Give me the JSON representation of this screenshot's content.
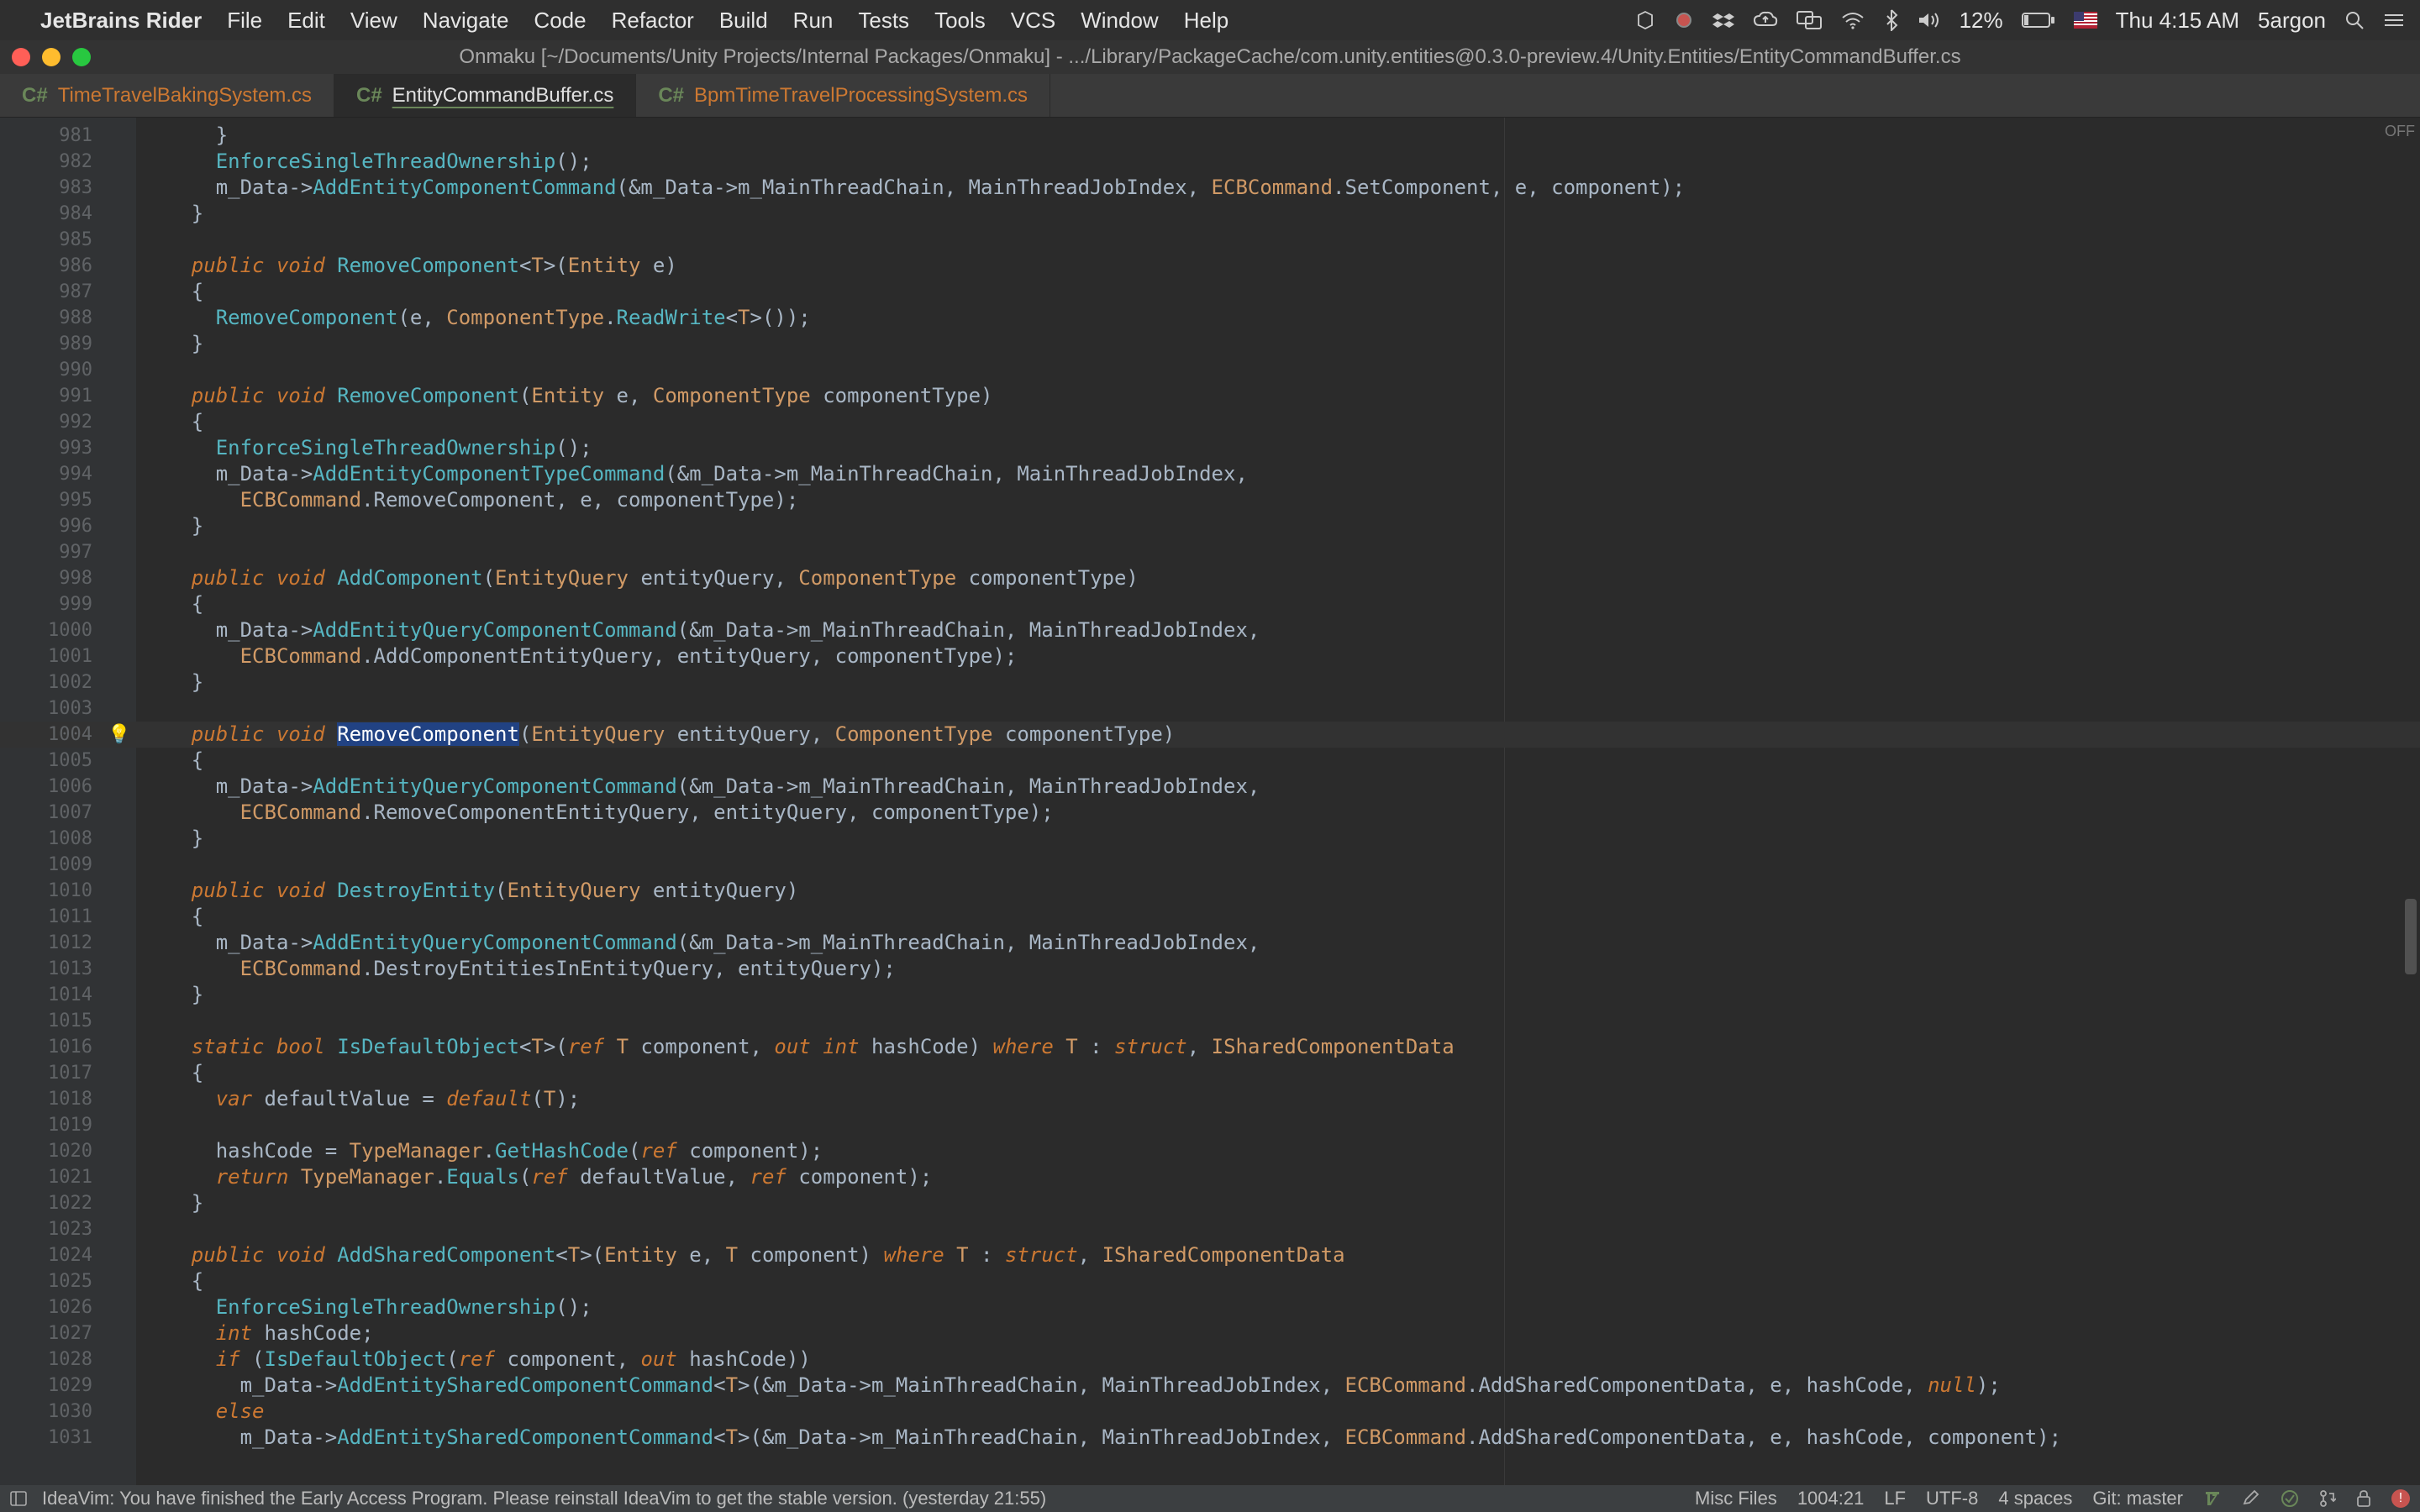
{
  "menubar": {
    "app": "JetBrains Rider",
    "items": [
      "File",
      "Edit",
      "View",
      "Navigate",
      "Code",
      "Refactor",
      "Build",
      "Run",
      "Tests",
      "Tools",
      "VCS",
      "Window",
      "Help"
    ],
    "battery": "12%",
    "clock": "Thu 4:15 AM",
    "user": "5argon"
  },
  "titlebar": "Onmaku [~/Documents/Unity Projects/Internal Packages/Onmaku] - .../Library/PackageCache/com.unity.entities@0.3.0-preview.4/Unity.Entities/EntityCommandBuffer.cs",
  "tabs": [
    {
      "lang": "C#",
      "label": "TimeTravelBakingSystem.cs",
      "active": false
    },
    {
      "lang": "C#",
      "label": "EntityCommandBuffer.cs",
      "active": true
    },
    {
      "lang": "C#",
      "label": "BpmTimeTravelProcessingSystem.cs",
      "active": false
    }
  ],
  "inspection": "OFF",
  "current_line": 1004,
  "code": [
    {
      "n": 981,
      "spans": [
        [
          "",
          "      "
        ],
        [
          "",
          "}"
        ]
      ]
    },
    {
      "n": 982,
      "spans": [
        [
          "",
          "      "
        ],
        [
          "mth",
          "EnforceSingleThreadOwnership"
        ],
        [
          "",
          "();"
        ]
      ]
    },
    {
      "n": 983,
      "spans": [
        [
          "",
          "      m_Data->"
        ],
        [
          "mth",
          "AddEntityComponentCommand"
        ],
        [
          "",
          "(&m_Data->m_MainThreadChain, MainThreadJobIndex, "
        ],
        [
          "cls",
          "ECBCommand"
        ],
        [
          "",
          "."
        ],
        [
          "id",
          "SetComponent"
        ],
        [
          "",
          ", "
        ],
        [
          "id",
          "e"
        ],
        [
          "",
          ", "
        ],
        [
          "id",
          "component"
        ],
        [
          "",
          ");"
        ]
      ]
    },
    {
      "n": 984,
      "spans": [
        [
          "",
          "    }"
        ]
      ]
    },
    {
      "n": 985,
      "spans": [
        [
          "",
          ""
        ]
      ]
    },
    {
      "n": 986,
      "spans": [
        [
          "",
          "    "
        ],
        [
          "kw",
          "public void"
        ],
        [
          "",
          ""
        ],
        [
          "",
          ""
        ],
        [
          "",
          " "
        ],
        [
          "mth",
          "RemoveComponent"
        ],
        [
          "",
          "<"
        ],
        [
          "typ",
          "T"
        ],
        [
          "",
          ">("
        ],
        [
          "typ",
          "Entity"
        ],
        [
          "",
          " e)"
        ]
      ]
    },
    {
      "n": 987,
      "spans": [
        [
          "",
          "    {"
        ]
      ]
    },
    {
      "n": 988,
      "spans": [
        [
          "",
          "      "
        ],
        [
          "mth",
          "RemoveComponent"
        ],
        [
          "",
          "(e, "
        ],
        [
          "typ",
          "ComponentType"
        ],
        [
          "",
          "."
        ],
        [
          "mth",
          "ReadWrite"
        ],
        [
          "",
          "<"
        ],
        [
          "typ",
          "T"
        ],
        [
          "",
          ">());"
        ]
      ]
    },
    {
      "n": 989,
      "spans": [
        [
          "",
          "    }"
        ]
      ]
    },
    {
      "n": 990,
      "spans": [
        [
          "",
          ""
        ]
      ]
    },
    {
      "n": 991,
      "spans": [
        [
          "",
          "    "
        ],
        [
          "kw",
          "public void"
        ],
        [
          "",
          " "
        ],
        [
          "mth",
          "RemoveComponent"
        ],
        [
          "",
          "("
        ],
        [
          "typ",
          "Entity"
        ],
        [
          "",
          " e, "
        ],
        [
          "typ",
          "ComponentType"
        ],
        [
          "",
          " componentType)"
        ]
      ]
    },
    {
      "n": 992,
      "spans": [
        [
          "",
          "    {"
        ]
      ]
    },
    {
      "n": 993,
      "spans": [
        [
          "",
          "      "
        ],
        [
          "mth",
          "EnforceSingleThreadOwnership"
        ],
        [
          "",
          "();"
        ]
      ]
    },
    {
      "n": 994,
      "spans": [
        [
          "",
          "      m_Data->"
        ],
        [
          "mth",
          "AddEntityComponentTypeCommand"
        ],
        [
          "",
          "(&m_Data->m_MainThreadChain, MainThreadJobIndex,"
        ]
      ]
    },
    {
      "n": 995,
      "spans": [
        [
          "",
          "        "
        ],
        [
          "cls",
          "ECBCommand"
        ],
        [
          "",
          "."
        ],
        [
          "id",
          "RemoveComponent"
        ],
        [
          "",
          ", e, componentType);"
        ]
      ]
    },
    {
      "n": 996,
      "spans": [
        [
          "",
          "    }"
        ]
      ]
    },
    {
      "n": 997,
      "spans": [
        [
          "",
          ""
        ]
      ]
    },
    {
      "n": 998,
      "spans": [
        [
          "",
          "    "
        ],
        [
          "kw",
          "public void"
        ],
        [
          "",
          " "
        ],
        [
          "mth",
          "AddComponent"
        ],
        [
          "",
          "("
        ],
        [
          "typ",
          "EntityQuery"
        ],
        [
          "",
          " entityQuery, "
        ],
        [
          "typ",
          "ComponentType"
        ],
        [
          "",
          " componentType)"
        ]
      ]
    },
    {
      "n": 999,
      "spans": [
        [
          "",
          "    {"
        ]
      ]
    },
    {
      "n": 1000,
      "spans": [
        [
          "",
          "      m_Data->"
        ],
        [
          "mth",
          "AddEntityQueryComponentCommand"
        ],
        [
          "",
          "(&m_Data->m_MainThreadChain, MainThreadJobIndex,"
        ]
      ]
    },
    {
      "n": 1001,
      "spans": [
        [
          "",
          "        "
        ],
        [
          "cls",
          "ECBCommand"
        ],
        [
          "",
          "."
        ],
        [
          "id",
          "AddComponentEntityQuery"
        ],
        [
          "",
          ", entityQuery, componentType);"
        ]
      ]
    },
    {
      "n": 1002,
      "spans": [
        [
          "",
          "    }"
        ]
      ]
    },
    {
      "n": 1003,
      "spans": [
        [
          "",
          ""
        ]
      ]
    },
    {
      "n": 1004,
      "spans": [
        [
          "",
          "    "
        ],
        [
          "kw",
          "public void"
        ],
        [
          "",
          " "
        ],
        [
          "sel",
          "RemoveComponent"
        ],
        [
          "",
          "("
        ],
        [
          "typ",
          "EntityQuery"
        ],
        [
          "",
          " entityQuery, "
        ],
        [
          "typ",
          "ComponentType"
        ],
        [
          "",
          " componentType)"
        ]
      ]
    },
    {
      "n": 1005,
      "spans": [
        [
          "",
          "    {"
        ]
      ]
    },
    {
      "n": 1006,
      "spans": [
        [
          "",
          "      m_Data->"
        ],
        [
          "mth",
          "AddEntityQueryComponentCommand"
        ],
        [
          "",
          "(&m_Data->m_MainThreadChain, MainThreadJobIndex,"
        ]
      ]
    },
    {
      "n": 1007,
      "spans": [
        [
          "",
          "        "
        ],
        [
          "cls",
          "ECBCommand"
        ],
        [
          "",
          "."
        ],
        [
          "id",
          "RemoveComponentEntityQuery"
        ],
        [
          "",
          ", entityQuery, componentType);"
        ]
      ]
    },
    {
      "n": 1008,
      "spans": [
        [
          "",
          "    }"
        ]
      ]
    },
    {
      "n": 1009,
      "spans": [
        [
          "",
          ""
        ]
      ]
    },
    {
      "n": 1010,
      "spans": [
        [
          "",
          "    "
        ],
        [
          "kw",
          "public void"
        ],
        [
          "",
          " "
        ],
        [
          "mth",
          "DestroyEntity"
        ],
        [
          "",
          "("
        ],
        [
          "typ",
          "EntityQuery"
        ],
        [
          "",
          " entityQuery)"
        ]
      ]
    },
    {
      "n": 1011,
      "spans": [
        [
          "",
          "    {"
        ]
      ]
    },
    {
      "n": 1012,
      "spans": [
        [
          "",
          "      m_Data->"
        ],
        [
          "mth",
          "AddEntityQueryComponentCommand"
        ],
        [
          "",
          "(&m_Data->m_MainThreadChain, MainThreadJobIndex,"
        ]
      ]
    },
    {
      "n": 1013,
      "spans": [
        [
          "",
          "        "
        ],
        [
          "cls",
          "ECBCommand"
        ],
        [
          "",
          "."
        ],
        [
          "id",
          "DestroyEntitiesInEntityQuery"
        ],
        [
          "",
          ", entityQuery);"
        ]
      ]
    },
    {
      "n": 1014,
      "spans": [
        [
          "",
          "    }"
        ]
      ]
    },
    {
      "n": 1015,
      "spans": [
        [
          "",
          ""
        ]
      ]
    },
    {
      "n": 1016,
      "spans": [
        [
          "",
          "    "
        ],
        [
          "kw",
          "static bool"
        ],
        [
          "",
          " "
        ],
        [
          "mth",
          "IsDefaultObject"
        ],
        [
          "",
          "<"
        ],
        [
          "typ",
          "T"
        ],
        [
          "",
          ">("
        ],
        [
          "kw",
          "ref"
        ],
        [
          "",
          " "
        ],
        [
          "typ",
          "T"
        ],
        [
          "",
          " component, "
        ],
        [
          "kw",
          "out int"
        ],
        [
          "",
          " "
        ],
        [
          "id",
          "hashCode"
        ],
        [
          "",
          ") "
        ],
        [
          "kw",
          "where"
        ],
        [
          "",
          " "
        ],
        [
          "typ",
          "T"
        ],
        [
          "",
          " : "
        ],
        [
          "kw",
          "struct"
        ],
        [
          "",
          ", "
        ],
        [
          "typ",
          "ISharedComponentData"
        ]
      ]
    },
    {
      "n": 1017,
      "spans": [
        [
          "",
          "    {"
        ]
      ]
    },
    {
      "n": 1018,
      "spans": [
        [
          "",
          "      "
        ],
        [
          "kw",
          "var"
        ],
        [
          "",
          " defaultValue = "
        ],
        [
          "kw",
          "default"
        ],
        [
          "",
          "("
        ],
        [
          "typ",
          "T"
        ],
        [
          "",
          ");"
        ]
      ]
    },
    {
      "n": 1019,
      "spans": [
        [
          "",
          ""
        ]
      ]
    },
    {
      "n": 1020,
      "spans": [
        [
          "",
          "      hashCode = "
        ],
        [
          "typ",
          "TypeManager"
        ],
        [
          "",
          "."
        ],
        [
          "mth",
          "GetHashCode"
        ],
        [
          "",
          "("
        ],
        [
          "kw",
          "ref"
        ],
        [
          "",
          " component);"
        ]
      ]
    },
    {
      "n": 1021,
      "spans": [
        [
          "",
          "      "
        ],
        [
          "kw",
          "return"
        ],
        [
          "",
          " "
        ],
        [
          "typ",
          "TypeManager"
        ],
        [
          "",
          "."
        ],
        [
          "mth",
          "Equals"
        ],
        [
          "",
          "("
        ],
        [
          "kw",
          "ref"
        ],
        [
          "",
          " defaultValue, "
        ],
        [
          "kw",
          "ref"
        ],
        [
          "",
          " component);"
        ]
      ]
    },
    {
      "n": 1022,
      "spans": [
        [
          "",
          "    }"
        ]
      ]
    },
    {
      "n": 1023,
      "spans": [
        [
          "",
          ""
        ]
      ]
    },
    {
      "n": 1024,
      "spans": [
        [
          "",
          "    "
        ],
        [
          "kw",
          "public void"
        ],
        [
          "",
          " "
        ],
        [
          "mth",
          "AddSharedComponent"
        ],
        [
          "",
          "<"
        ],
        [
          "typ",
          "T"
        ],
        [
          "",
          ">("
        ],
        [
          "typ",
          "Entity"
        ],
        [
          "",
          " e, "
        ],
        [
          "typ",
          "T"
        ],
        [
          "",
          " component) "
        ],
        [
          "kw",
          "where"
        ],
        [
          "",
          " "
        ],
        [
          "typ",
          "T"
        ],
        [
          "",
          " : "
        ],
        [
          "kw",
          "struct"
        ],
        [
          "",
          ", "
        ],
        [
          "typ",
          "ISharedComponentData"
        ]
      ]
    },
    {
      "n": 1025,
      "spans": [
        [
          "",
          "    {"
        ]
      ]
    },
    {
      "n": 1026,
      "spans": [
        [
          "",
          "      "
        ],
        [
          "mth",
          "EnforceSingleThreadOwnership"
        ],
        [
          "",
          "();"
        ]
      ]
    },
    {
      "n": 1027,
      "spans": [
        [
          "",
          "      "
        ],
        [
          "kw",
          "int"
        ],
        [
          "",
          " hashCode;"
        ]
      ]
    },
    {
      "n": 1028,
      "spans": [
        [
          "",
          "      "
        ],
        [
          "kw",
          "if"
        ],
        [
          "",
          " ("
        ],
        [
          "mth",
          "IsDefaultObject"
        ],
        [
          "",
          "("
        ],
        [
          "kw",
          "ref"
        ],
        [
          "",
          " component, "
        ],
        [
          "kw",
          "out"
        ],
        [
          "",
          " hashCode))"
        ]
      ]
    },
    {
      "n": 1029,
      "spans": [
        [
          "",
          "        m_Data->"
        ],
        [
          "mth",
          "AddEntitySharedComponentCommand"
        ],
        [
          "",
          "<"
        ],
        [
          "typ",
          "T"
        ],
        [
          "",
          ">(&m_Data->m_MainThreadChain, MainThreadJobIndex, "
        ],
        [
          "cls",
          "ECBCommand"
        ],
        [
          "",
          "."
        ],
        [
          "id",
          "AddSharedComponentData"
        ],
        [
          "",
          ", "
        ],
        [
          "id",
          "e"
        ],
        [
          "",
          ", hashCode, "
        ],
        [
          "kw",
          "null"
        ],
        [
          "",
          ");"
        ]
      ]
    },
    {
      "n": 1030,
      "spans": [
        [
          "",
          "      "
        ],
        [
          "kw",
          "else"
        ]
      ]
    },
    {
      "n": 1031,
      "spans": [
        [
          "",
          "        m_Data->"
        ],
        [
          "mth",
          "AddEntitySharedComponentCommand"
        ],
        [
          "",
          "<"
        ],
        [
          "typ",
          "T"
        ],
        [
          "",
          ">(&m_Data->m_MainThreadChain, MainThreadJobIndex, "
        ],
        [
          "cls",
          "ECBCommand"
        ],
        [
          "",
          "."
        ],
        [
          "id",
          "AddSharedComponentData"
        ],
        [
          "",
          ", "
        ],
        [
          "id",
          "e"
        ],
        [
          "",
          ", hashCode, "
        ],
        [
          "id",
          "component"
        ],
        [
          "",
          ");"
        ]
      ]
    }
  ],
  "statusbar": {
    "msg": "IdeaVim: You have finished the Early Access Program. Please reinstall IdeaVim to get the stable version. (yesterday 21:55)",
    "misc": "Misc Files",
    "pos": "1004:21",
    "eol": "LF",
    "enc": "UTF-8",
    "indent": "4 spaces",
    "git": "Git: master"
  }
}
